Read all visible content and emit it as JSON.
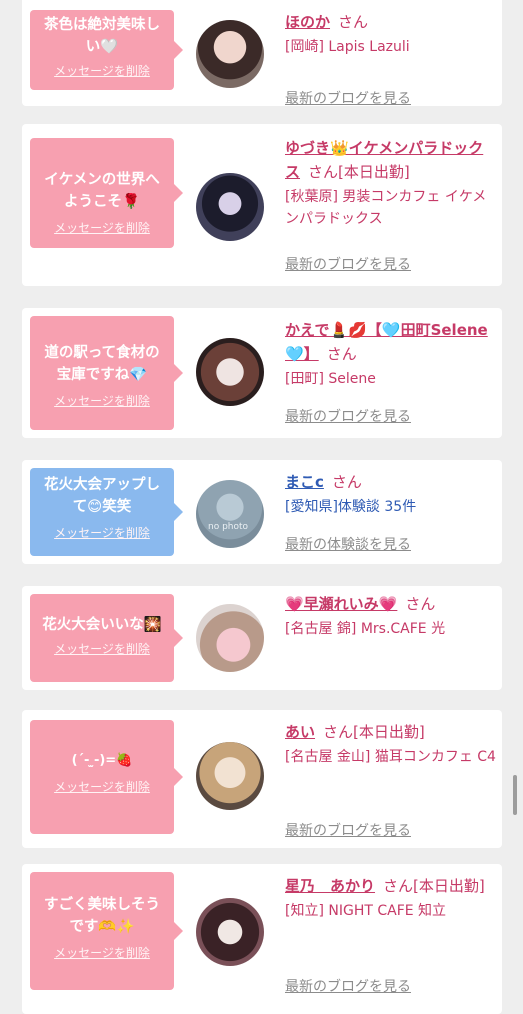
{
  "common": {
    "san": "さん",
    "delete": "メッセージを削除",
    "blog": "最新のブログを見る",
    "review": "最新の体験談を見る",
    "nophoto": "no photo"
  },
  "cards": [
    {
      "msg": "茶色は絶対美味しい🤍",
      "name": "ほのか",
      "tag": "",
      "shop": "[岡崎] Lapis Lazuli"
    },
    {
      "msg": "イケメンの世界へようこそ🌹",
      "name": "ゆづき👑イケメンパラドックス",
      "tag": "[本日出勤]",
      "shop": "[秋葉原] 男装コンカフェ イケメンパラドックス"
    },
    {
      "msg": "道の駅って食材の宝庫ですね💎",
      "name": "かえで💄💋【🩵田町Selene🩵】",
      "tag": "",
      "shop": "[田町] Selene"
    },
    {
      "msg": "花火大会アップして😊笑笑",
      "name": "まこc",
      "tag": "",
      "shop": "[愛知県]体験談 35件"
    },
    {
      "msg": "花火大会いいな🎇",
      "name": "💗早瀬れいみ💗",
      "tag": "",
      "shop": "[名古屋 錦] Mrs.CAFE 光"
    },
    {
      "msg": "(´- ̫-)=🍓",
      "name": "あい",
      "tag": "[本日出勤]",
      "shop": "[名古屋 金山] 猫耳コンカフェ C4"
    },
    {
      "msg": "すごく美味しそうです🫶✨",
      "name": "星乃　あかり",
      "tag": "[本日出勤]",
      "shop": "[知立] NIGHT CAFE 知立"
    }
  ],
  "colors": {
    "pink_bubble": "#f7a0b0",
    "blue_bubble": "#8ab9ee",
    "name_pink": "#c63a67",
    "name_blue": "#2f5bb4"
  }
}
